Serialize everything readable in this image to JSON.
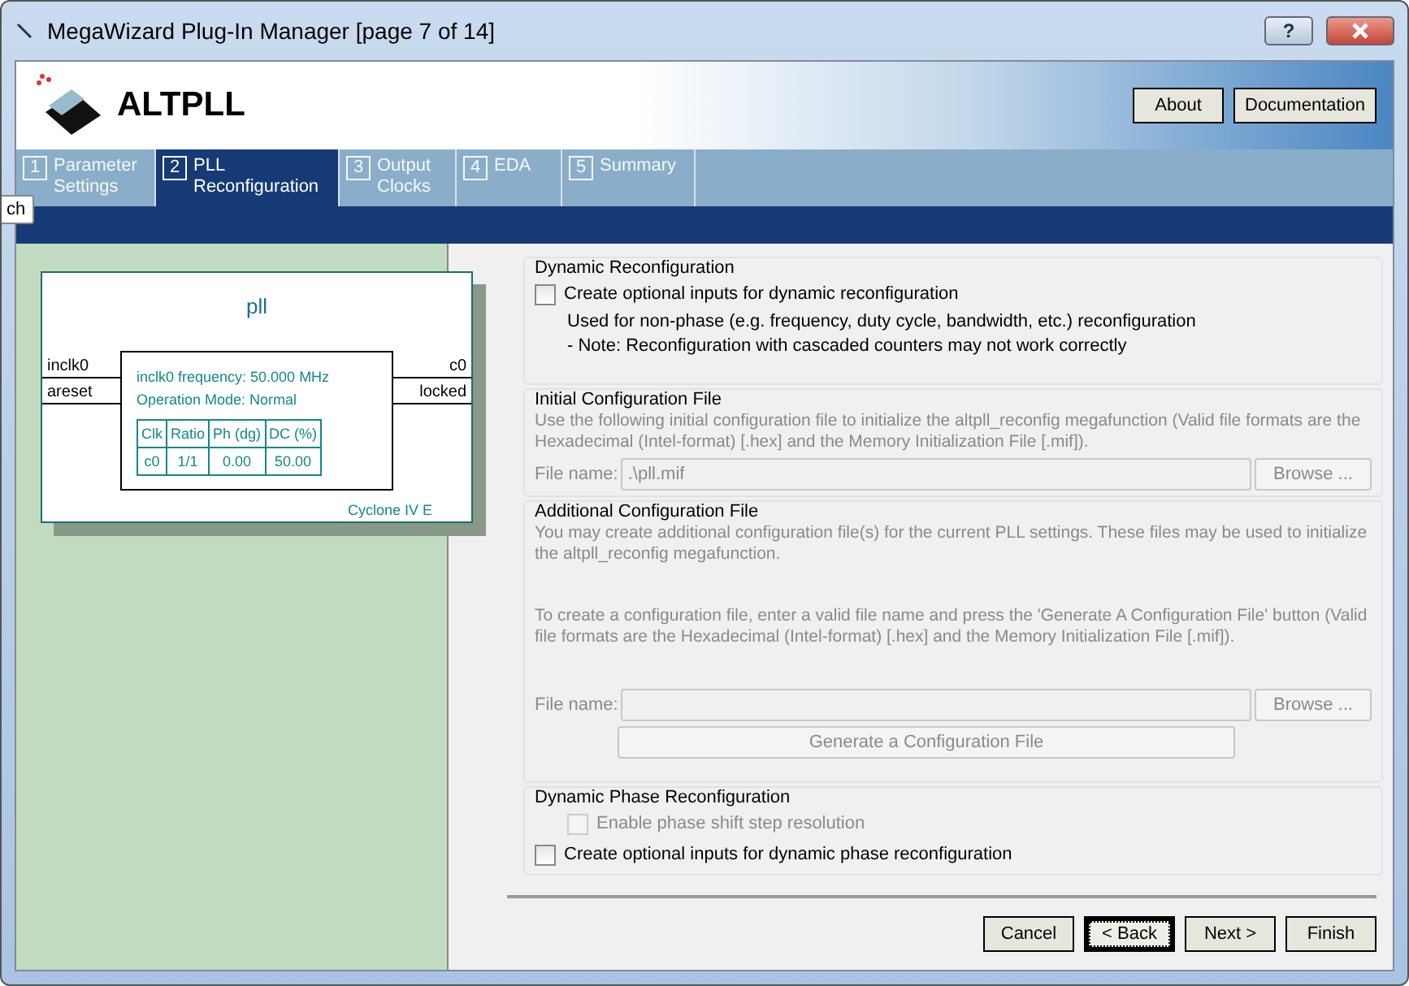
{
  "window": {
    "title": "MegaWizard Plug-In Manager [page 7 of 14]",
    "help": "?"
  },
  "header": {
    "title": "ALTPLL",
    "buttons": [
      "About",
      "Documentation"
    ]
  },
  "tabs": [
    {
      "number": "1",
      "label": "Parameter Settings",
      "selected": false
    },
    {
      "number": "2",
      "label": "PLL Reconfiguration",
      "selected": true
    },
    {
      "number": "3",
      "label": "Output Clocks",
      "selected": false
    },
    {
      "number": "4",
      "label": "EDA",
      "selected": false
    },
    {
      "number": "5",
      "label": "Summary",
      "selected": false
    }
  ],
  "tooltip": "ch",
  "symbol": {
    "name": "pll",
    "inputs": [
      "inclk0",
      "areset"
    ],
    "outputs": [
      "c0",
      "locked"
    ],
    "info": [
      "inclk0 frequency: 50.000 MHz",
      "Operation Mode: Normal"
    ],
    "columns": [
      "Clk",
      "Ratio",
      "Ph (dg)",
      "DC (%)"
    ],
    "rows": [
      [
        "c0",
        "1/1",
        "0.00",
        "50.00"
      ]
    ],
    "device": "Cyclone IV E"
  },
  "dynamic_reconfiguration": {
    "title": "Dynamic Reconfiguration",
    "checkbox": {
      "label": "Create optional inputs for dynamic reconfiguration",
      "checked": false
    },
    "notes": [
      "Used for non-phase (e.g. frequency, duty cycle, bandwidth, etc.) reconfiguration",
      "- Note: Reconfiguration with cascaded counters may not work correctly"
    ]
  },
  "initial_file": {
    "title": "Initial Configuration File",
    "text": "Use the following initial configuration file to initialize the altpll_reconfig megafunction (Valid file formats are the Hexadecimal (Intel-format) [.hex] and the Memory Initialization File [.mif]).",
    "label": "File name:",
    "value": ".\\pll.mif",
    "browse": "Browse ..."
  },
  "additional_file": {
    "title": "Additional Configuration File",
    "text": "You may create additional configuration file(s) for the current PLL settings. These files may be used to initialize the altpll_reconfig megafunction.",
    "text2": "To create a configuration file, enter a valid file name and press the 'Generate A Configuration File' button (Valid file formats are the Hexadecimal (Intel-format) [.hex] and the Memory Initialization File [.mif]).",
    "label": "File name:",
    "browse": "Browse ...",
    "generate": "Generate a Configuration File"
  },
  "dynamic_phase": {
    "title": "Dynamic Phase Reconfiguration",
    "options": [
      {
        "label": "Enable phase shift step resolution",
        "checked": false,
        "disabled": true
      },
      {
        "label": "Create optional inputs for dynamic phase reconfiguration",
        "checked": false,
        "disabled": false
      }
    ]
  },
  "footer": {
    "buttons": [
      {
        "label": "Cancel",
        "focused": false
      },
      {
        "label": "< Back",
        "focused": true
      },
      {
        "label": "Next >",
        "focused": false
      },
      {
        "label": "Finish",
        "focused": false
      }
    ]
  }
}
